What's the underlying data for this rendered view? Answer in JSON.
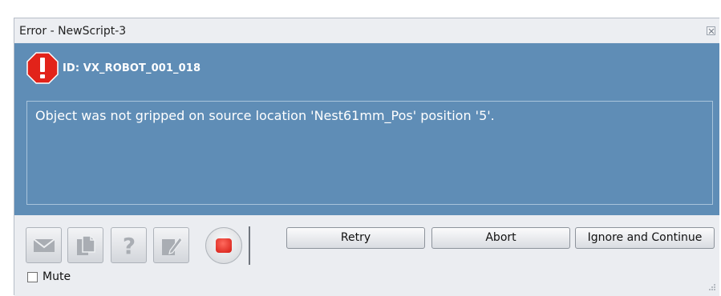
{
  "window": {
    "title": "Error - NewScript-3"
  },
  "error": {
    "id_label": "ID: VX_ROBOT_001_018",
    "message": "Object was not gripped on source location 'Nest61mm_Pos' position '5'."
  },
  "toolbar": {
    "icons": [
      "mail-icon",
      "copy-icon",
      "help-icon",
      "edit-icon",
      "stop-icon"
    ]
  },
  "actions": {
    "retry_label": "Retry",
    "abort_label": "Abort",
    "ignore_label": "Ignore and Continue"
  },
  "mute": {
    "label": "Mute",
    "checked": false
  },
  "colors": {
    "panel_blue": "#5f8db6",
    "error_red": "#e2231a"
  }
}
